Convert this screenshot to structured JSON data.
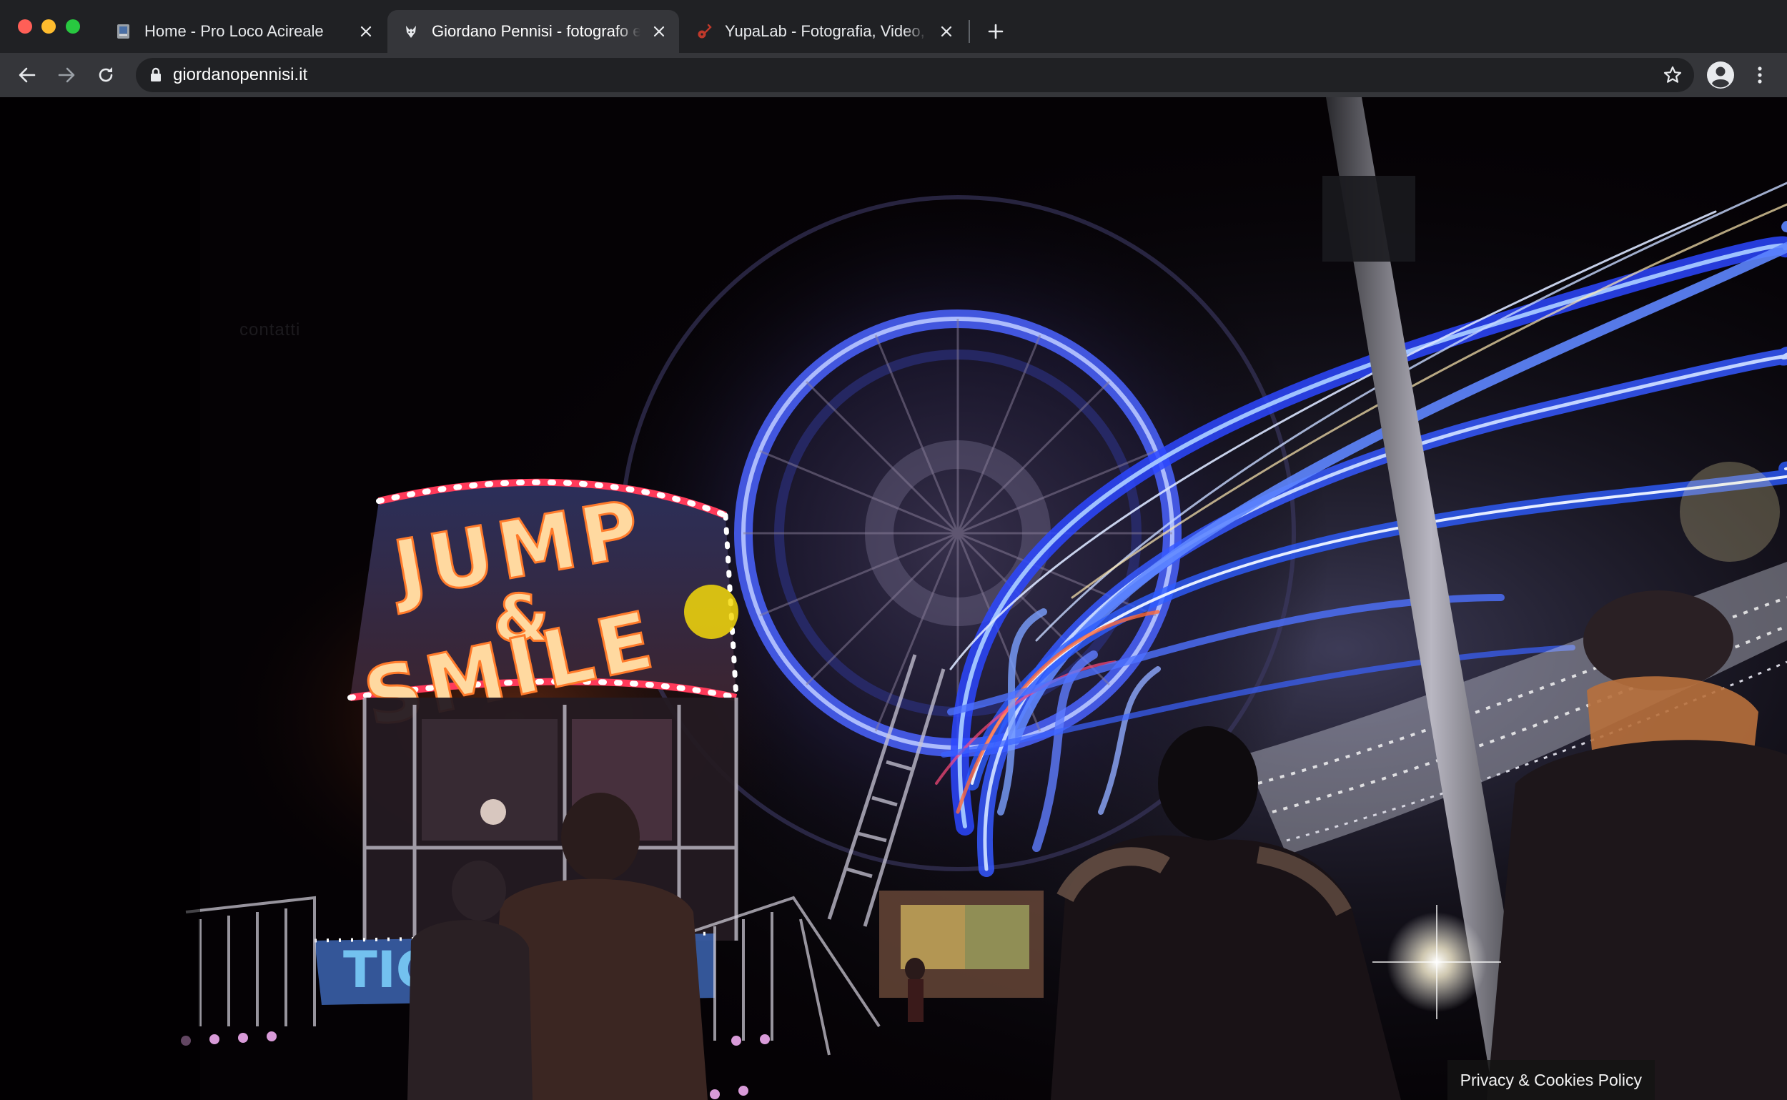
{
  "browser": {
    "tabs": [
      {
        "title": "Home - Pro Loco Acireale",
        "favicon": "page-favicon-icon",
        "active": false
      },
      {
        "title": "Giordano Pennisi - fotografo e",
        "favicon": "fox-favicon-icon",
        "active": true
      },
      {
        "title": "YupaLab - Fotografia, Video, G",
        "favicon": "guitar-favicon-icon",
        "active": false
      }
    ],
    "new_tab_icon": "plus-icon",
    "address": {
      "url": "giordanopennisi.it",
      "secure_icon": "lock-icon"
    },
    "toolbar_icons": [
      "back-arrow-icon",
      "forward-arrow-icon",
      "reload-icon",
      "star-icon",
      "profile-icon",
      "kebab-menu-icon"
    ]
  },
  "page": {
    "hero_alt_subject": "",
    "faint_text": "contatti",
    "cookie_link": "Privacy & Cookies Policy",
    "sign_text": "JUMP & SMILE"
  },
  "colors": {
    "tabstrip_bg": "#202124",
    "toolbar_bg": "#35363a",
    "omnibox_bg": "#202124",
    "text": "#e8eaed"
  }
}
